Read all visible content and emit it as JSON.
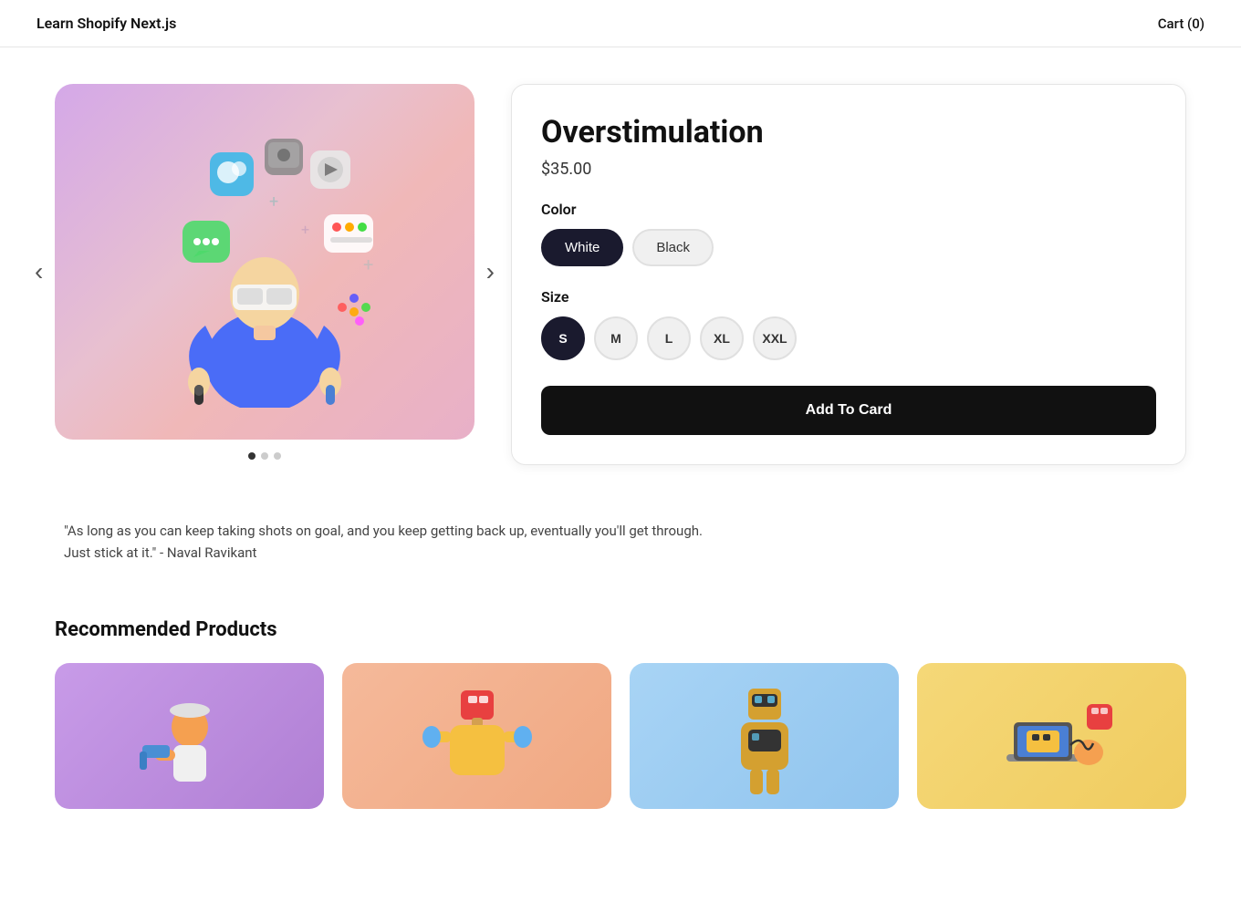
{
  "header": {
    "title": "Learn Shopify Next.js",
    "cart_label": "Cart (0)"
  },
  "product": {
    "name": "Overstimulation",
    "price": "$35.00",
    "color_label": "Color",
    "colors": [
      {
        "label": "White",
        "selected": true
      },
      {
        "label": "Black",
        "selected": false
      }
    ],
    "size_label": "Size",
    "sizes": [
      {
        "label": "S",
        "selected": true
      },
      {
        "label": "M",
        "selected": false
      },
      {
        "label": "L",
        "selected": false
      },
      {
        "label": "XL",
        "selected": false
      },
      {
        "label": "XXL",
        "selected": false
      }
    ],
    "add_to_cart_label": "Add To Card",
    "carousel_dots": [
      {
        "active": true
      },
      {
        "active": false
      },
      {
        "active": false
      }
    ],
    "prev_arrow": "‹",
    "next_arrow": "›"
  },
  "quote": {
    "text": "\"As long as you can keep taking shots on goal, and you keep getting back up, eventually you'll get through. Just stick at it.\" - Naval Ravikant"
  },
  "recommended": {
    "title": "Recommended Products",
    "products": [
      {
        "id": 1
      },
      {
        "id": 2
      },
      {
        "id": 3
      },
      {
        "id": 4
      }
    ]
  }
}
